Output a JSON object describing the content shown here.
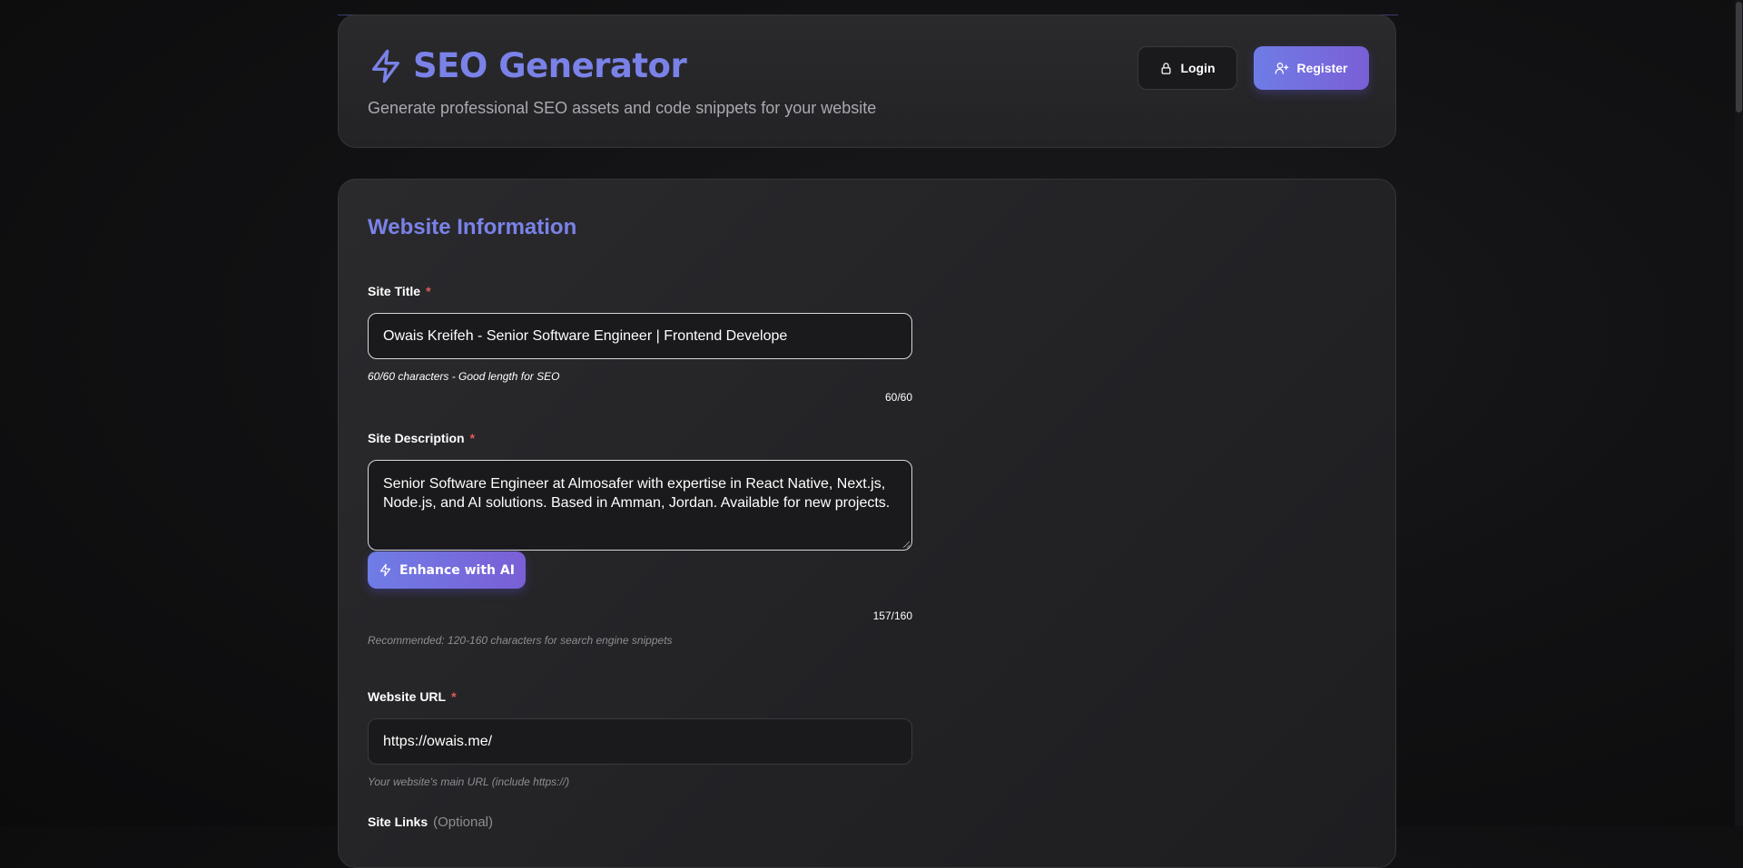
{
  "header": {
    "title": "SEO Generator",
    "subtitle": "Generate professional SEO assets and code snippets for your website",
    "brand_icon": "lightning-icon",
    "login_label": "Login",
    "register_label": "Register"
  },
  "form": {
    "section_title": "Website Information",
    "site_title": {
      "label": "Site Title",
      "required_mark": "*",
      "value": "Owais Kreifeh - Senior Software Engineer | Frontend Develope",
      "hint": "60/60 characters - Good length for SEO",
      "counter": "60/60"
    },
    "site_description": {
      "label": "Site Description",
      "required_mark": "*",
      "value": "Senior Software Engineer at Almosafer with expertise in React Native, Next.js, Node.js, and AI solutions. Based in Amman, Jordan. Available for new projects.",
      "enhance_label": "Enhance with AI",
      "counter": "157/160",
      "hint": "Recommended: 120-160 characters for search engine snippets"
    },
    "website_url": {
      "label": "Website URL",
      "required_mark": "*",
      "value": "https://owais.me/",
      "hint": "Your website's main URL (include https://)"
    },
    "site_links": {
      "label": "Site Links",
      "optional": "(Optional)"
    }
  },
  "colors": {
    "accent": "#7a82e8",
    "gradient_start": "#6f7ce6",
    "gradient_end": "#7a5fd6",
    "required": "#e05a5a"
  }
}
